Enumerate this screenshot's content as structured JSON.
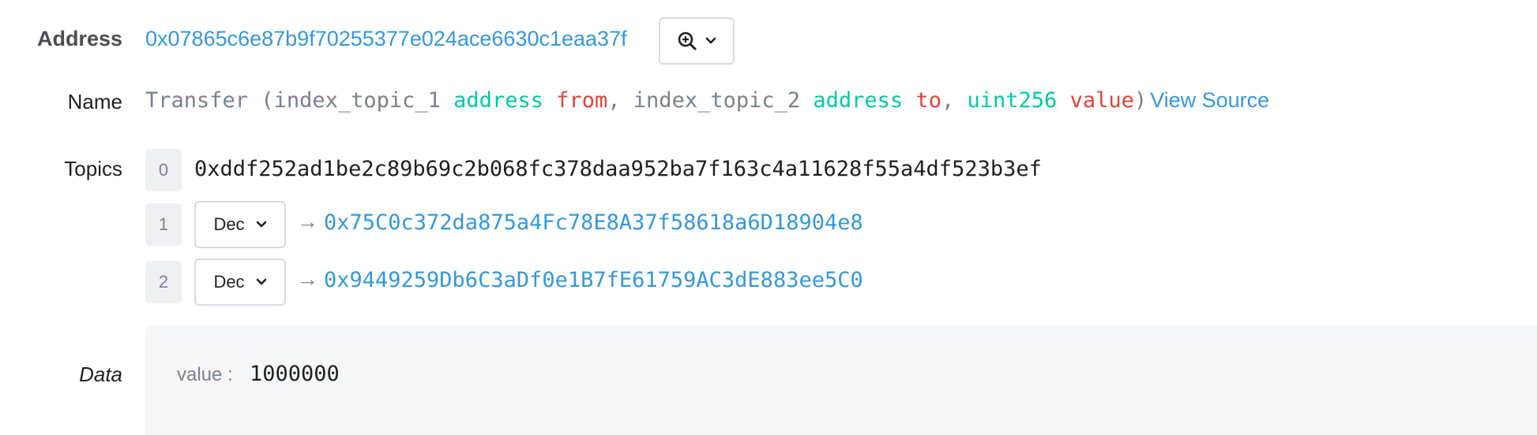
{
  "address": {
    "label": "Address",
    "value": "0x07865c6e87b9f70255377e024ace6630c1eaa37f"
  },
  "name": {
    "label": "Name",
    "event": "Transfer",
    "open_paren": "(",
    "p1_index": "index_topic_1",
    "p1_type": "address",
    "p1_name": "from",
    "sep1": ",",
    "p2_index": "index_topic_2",
    "p2_type": "address",
    "p2_name": "to",
    "sep2": ",",
    "p3_type": "uint256",
    "p3_name": "value",
    "close_paren": ")",
    "view_source": "View Source"
  },
  "topics": {
    "label": "Topics",
    "items": [
      {
        "index": "0",
        "value": "0xddf252ad1be2c89b69c2b068fc378daa952ba7f163c4a11628f55a4df523b3ef"
      },
      {
        "index": "1",
        "format": "Dec",
        "arrow": "→",
        "value": "0x75C0c372da875a4Fc78E8A37f58618a6D18904e8"
      },
      {
        "index": "2",
        "format": "Dec",
        "arrow": "→",
        "value": "0x9449259Db6C3aDf0e1B7fE61759AC3dE883ee5C0"
      }
    ]
  },
  "data": {
    "label": "Data",
    "key": "value :",
    "value": "1000000"
  },
  "icons": {
    "lookup": "search-plus-icon",
    "dropdown": "chevron-down-icon"
  },
  "colors": {
    "link": "#3498db",
    "type": "#00c9a7",
    "variable": "#de4437",
    "muted": "#77838f"
  }
}
